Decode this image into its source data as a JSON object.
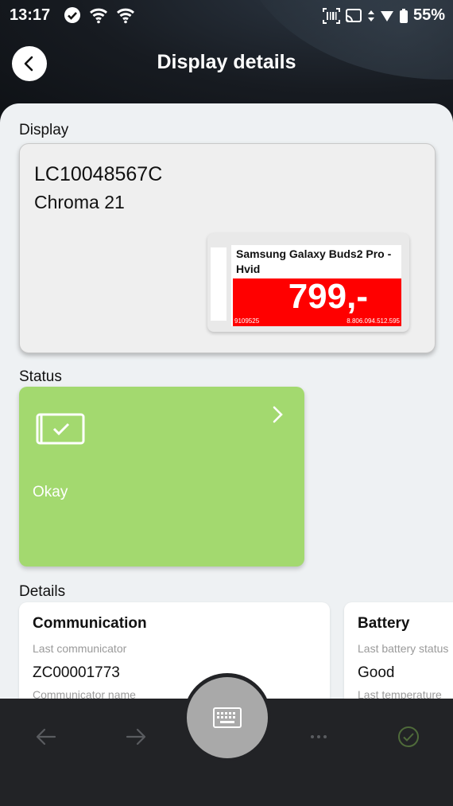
{
  "status_bar": {
    "time": "13:17",
    "battery": "55%"
  },
  "header": {
    "title": "Display details"
  },
  "display_section": {
    "label": "Display",
    "display_id": "LC10048567C",
    "model": "Chroma 21",
    "label_preview": {
      "product_name": "Samsung Galaxy Buds2 Pro - Hvid",
      "price": "799,-",
      "code_left": "9109525",
      "code_right": "8.806.094.512.595"
    }
  },
  "status_section": {
    "label": "Status",
    "status_text": "Okay",
    "color": "#a3d96f"
  },
  "details_section": {
    "label": "Details",
    "cards": [
      {
        "title": "Communication",
        "field1_label": "Last communicator",
        "field1_value": "ZC00001773",
        "field2_label": "Communicator name"
      },
      {
        "title": "Battery",
        "field1_label": "Last battery status",
        "field1_value": "Good",
        "field2_label": "Last temperature"
      }
    ]
  },
  "bottom_nav": {
    "items": [
      "arrow-left-icon",
      "arrow-right-icon",
      "keyboard-icon",
      "more-icon",
      "check-circle-icon"
    ]
  }
}
